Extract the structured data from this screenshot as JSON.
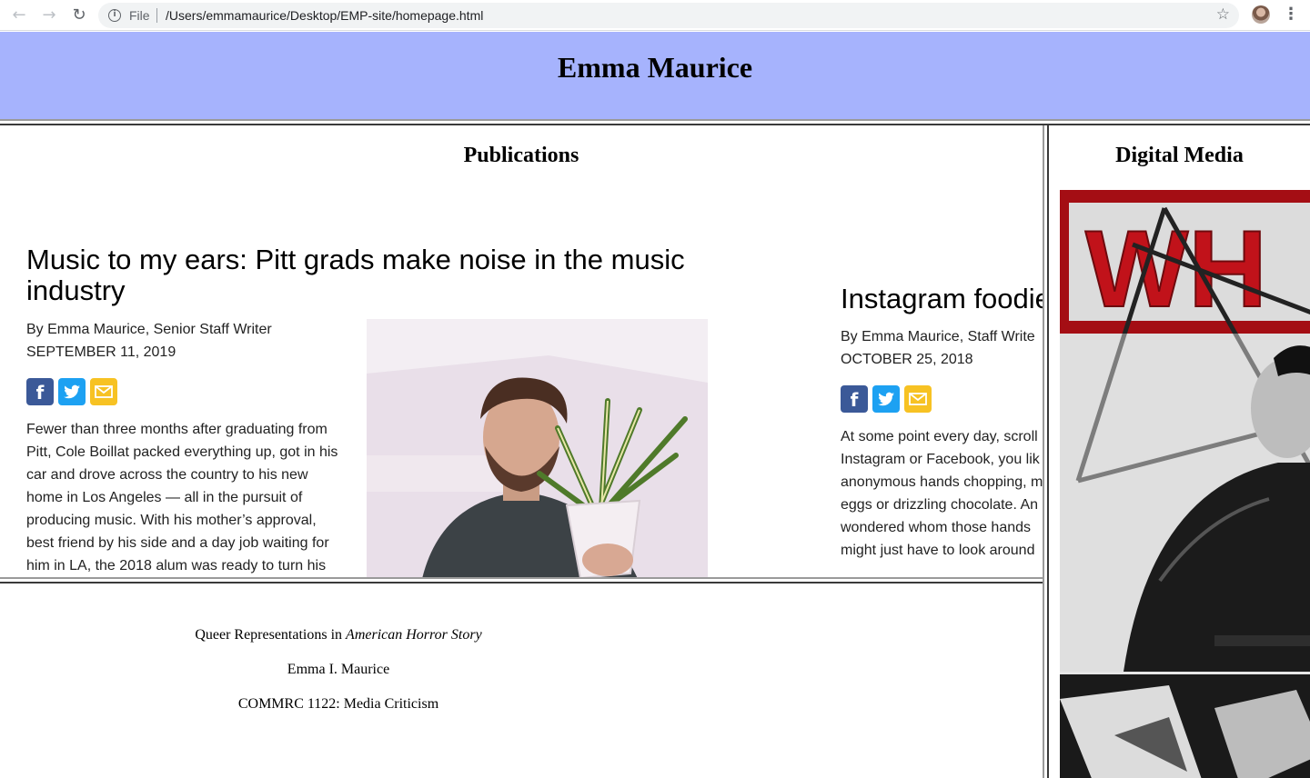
{
  "browser": {
    "scheme": "File",
    "url": "/Users/emmamaurice/Desktop/EMP-site/homepage.html",
    "icons": [
      "back-icon",
      "forward-icon",
      "reload-icon",
      "info-icon",
      "star-icon",
      "profile-avatar",
      "menu-icon"
    ]
  },
  "site": {
    "title": "Emma Maurice",
    "header_color": "#a6b3fd"
  },
  "publications": {
    "heading": "Publications",
    "articles": [
      {
        "title": "Music to my ears: Pitt grads make noise in the music industry",
        "byline": "By Emma Maurice, Senior Staff Writer",
        "date": "SEPTEMBER 11, 2019",
        "body": [
          "Fewer than three months after graduating from",
          "Pitt, Cole Boillat packed everything up, got in his",
          "car and drove across the country to his new",
          "home in Los Angeles — all in the pursuit of",
          "producing music. With his mother’s approval,",
          "best friend by his side and a day job waiting for",
          "him in LA, the 2018 alum was ready to turn his"
        ]
      },
      {
        "title": "Instagram foodie",
        "byline": "By Emma Maurice, Staff Write",
        "date": "OCTOBER 25, 2018",
        "body": [
          "At some point every day, scroll",
          "Instagram or Facebook, you lik",
          "anonymous hands chopping, m",
          "eggs or drizzling chocolate. An",
          "wondered whom those hands",
          "might just have to look around"
        ]
      }
    ],
    "share_icons": [
      "facebook-icon",
      "twitter-icon",
      "email-icon"
    ],
    "share_colors": {
      "facebook": "#3b5998",
      "twitter": "#1da1f2",
      "email": "#f7c223"
    }
  },
  "paper": {
    "title_prefix": "Queer Representations in ",
    "title_italic": "American Horror Story",
    "author": "Emma I. Maurice",
    "course": "COMMRC 1122: Media Criticism"
  },
  "digital_media": {
    "heading": "Digital Media",
    "poster_text": "WH"
  }
}
